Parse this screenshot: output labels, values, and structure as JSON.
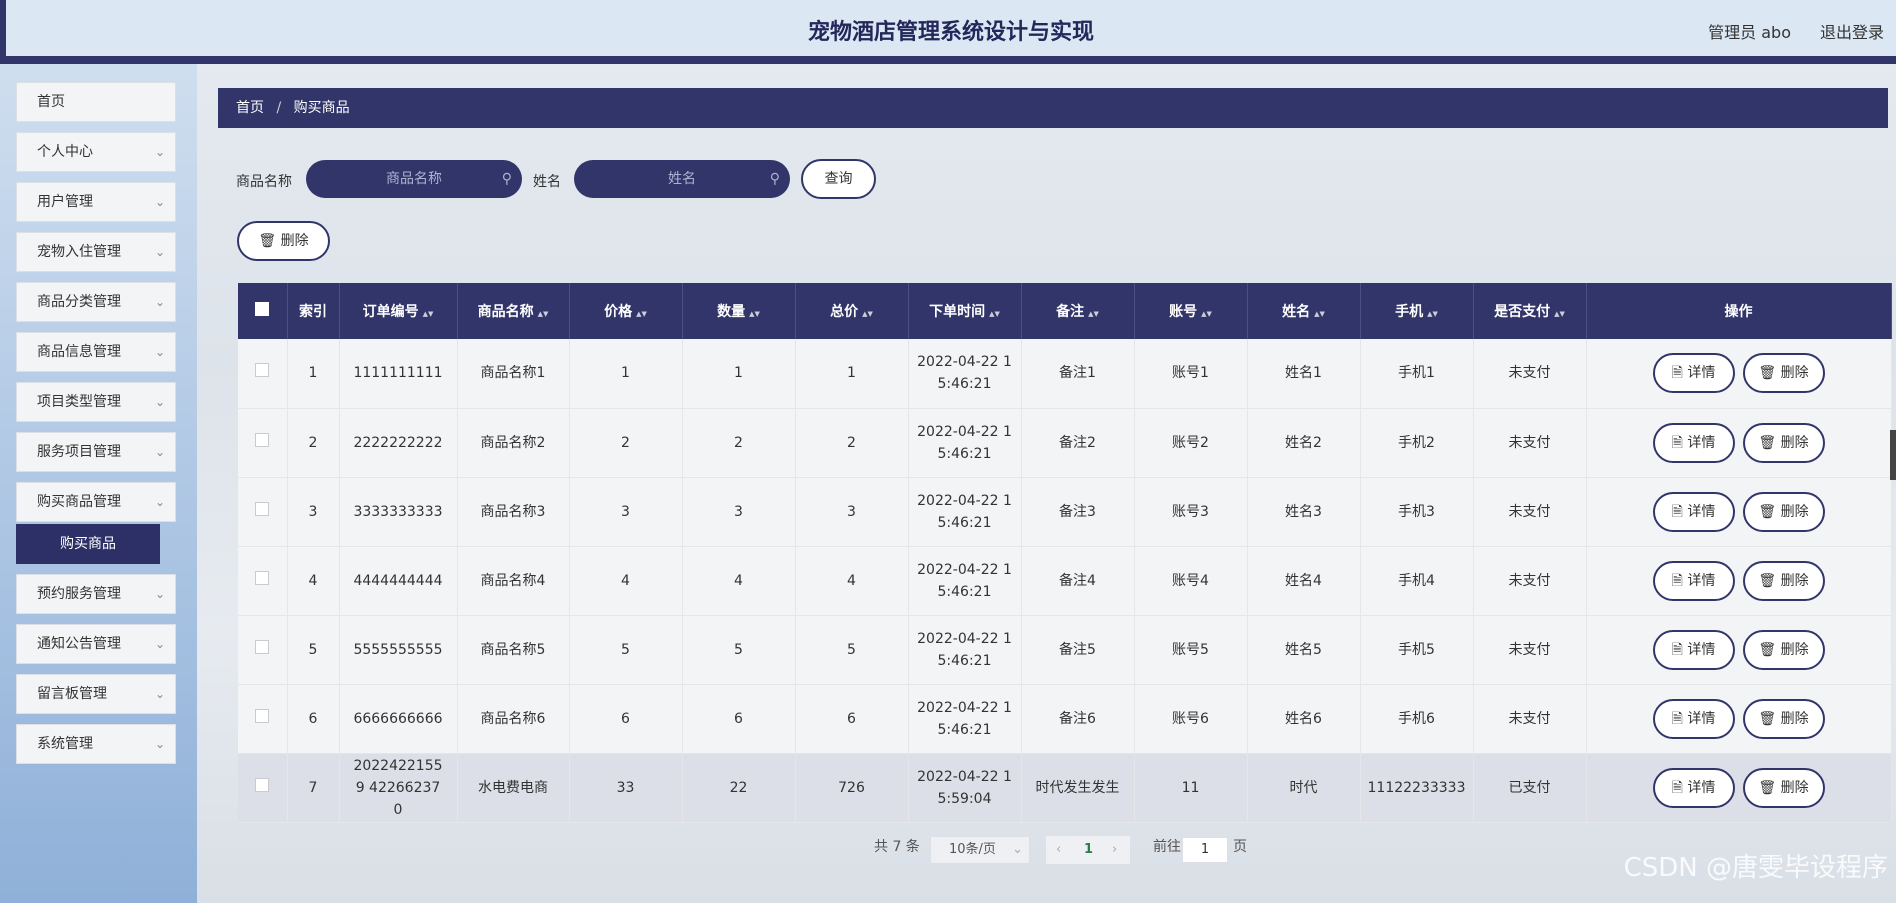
{
  "header": {
    "title": "宠物酒店管理系统设计与实现",
    "user": "管理员 abo",
    "logout": "退出登录"
  },
  "sidebar": {
    "items": [
      {
        "label": "首页",
        "chevron": false
      },
      {
        "label": "个人中心",
        "chevron": true
      },
      {
        "label": "用户管理",
        "chevron": true
      },
      {
        "label": "宠物入住管理",
        "chevron": true
      },
      {
        "label": "商品分类管理",
        "chevron": true
      },
      {
        "label": "商品信息管理",
        "chevron": true
      },
      {
        "label": "项目类型管理",
        "chevron": true
      },
      {
        "label": "服务项目管理",
        "chevron": true
      },
      {
        "label": "购买商品管理",
        "chevron": true
      },
      {
        "label": "预约服务管理",
        "chevron": true
      },
      {
        "label": "通知公告管理",
        "chevron": true
      },
      {
        "label": "留言板管理",
        "chevron": true
      },
      {
        "label": "系统管理",
        "chevron": true
      }
    ],
    "submenu_active": "购买商品"
  },
  "breadcrumb": {
    "home": "首页",
    "sep": "/",
    "current": "购买商品"
  },
  "search": {
    "goods_label": "商品名称",
    "goods_placeholder": "商品名称",
    "name_label": "姓名",
    "name_placeholder": "姓名",
    "query": "查询"
  },
  "toolbar": {
    "delete": "删除"
  },
  "table": {
    "columns": [
      "索引",
      "订单编号",
      "商品名称",
      "价格",
      "数量",
      "总价",
      "下单时间",
      "备注",
      "账号",
      "姓名",
      "手机",
      "是否支付",
      "操作"
    ],
    "rows": [
      {
        "idx": "1",
        "order": "1111111111",
        "goods": "商品名称1",
        "price": "1",
        "qty": "1",
        "total": "1",
        "time1": "2022-04-22 1",
        "time2": "5:46:21",
        "note": "备注1",
        "account": "账号1",
        "name": "姓名1",
        "phone": "手机1",
        "paid": "未支付"
      },
      {
        "idx": "2",
        "order": "2222222222",
        "goods": "商品名称2",
        "price": "2",
        "qty": "2",
        "total": "2",
        "time1": "2022-04-22 1",
        "time2": "5:46:21",
        "note": "备注2",
        "account": "账号2",
        "name": "姓名2",
        "phone": "手机2",
        "paid": "未支付"
      },
      {
        "idx": "3",
        "order": "3333333333",
        "goods": "商品名称3",
        "price": "3",
        "qty": "3",
        "total": "3",
        "time1": "2022-04-22 1",
        "time2": "5:46:21",
        "note": "备注3",
        "account": "账号3",
        "name": "姓名3",
        "phone": "手机3",
        "paid": "未支付"
      },
      {
        "idx": "4",
        "order": "4444444444",
        "goods": "商品名称4",
        "price": "4",
        "qty": "4",
        "total": "4",
        "time1": "2022-04-22 1",
        "time2": "5:46:21",
        "note": "备注4",
        "account": "账号4",
        "name": "姓名4",
        "phone": "手机4",
        "paid": "未支付"
      },
      {
        "idx": "5",
        "order": "5555555555",
        "goods": "商品名称5",
        "price": "5",
        "qty": "5",
        "total": "5",
        "time1": "2022-04-22 1",
        "time2": "5:46:21",
        "note": "备注5",
        "account": "账号5",
        "name": "姓名5",
        "phone": "手机5",
        "paid": "未支付"
      },
      {
        "idx": "6",
        "order": "6666666666",
        "goods": "商品名称6",
        "price": "6",
        "qty": "6",
        "total": "6",
        "time1": "2022-04-22 1",
        "time2": "5:46:21",
        "note": "备注6",
        "account": "账号6",
        "name": "姓名6",
        "phone": "手机6",
        "paid": "未支付"
      },
      {
        "idx": "7",
        "order": "20224221559 422662370",
        "goods": "水电费电商",
        "price": "33",
        "qty": "22",
        "total": "726",
        "time1": "2022-04-22 1",
        "time2": "5:59:04",
        "note": "时代发生发生",
        "account": "11",
        "name": "时代",
        "phone": "11122233333",
        "paid": "已支付"
      }
    ],
    "detail_label": "详情",
    "delete_label": "删除"
  },
  "pagination": {
    "total": "共 7 条",
    "page_size": "10条/页",
    "current_page": "1",
    "goto_label": "前往",
    "goto_value": "1",
    "page_unit": "页"
  },
  "watermark": "CSDN @唐雯毕设程序",
  "icons": {
    "search": "search-icon",
    "trash": "trash-icon",
    "doc": "document-icon",
    "chevron": "chevron-down-icon"
  }
}
